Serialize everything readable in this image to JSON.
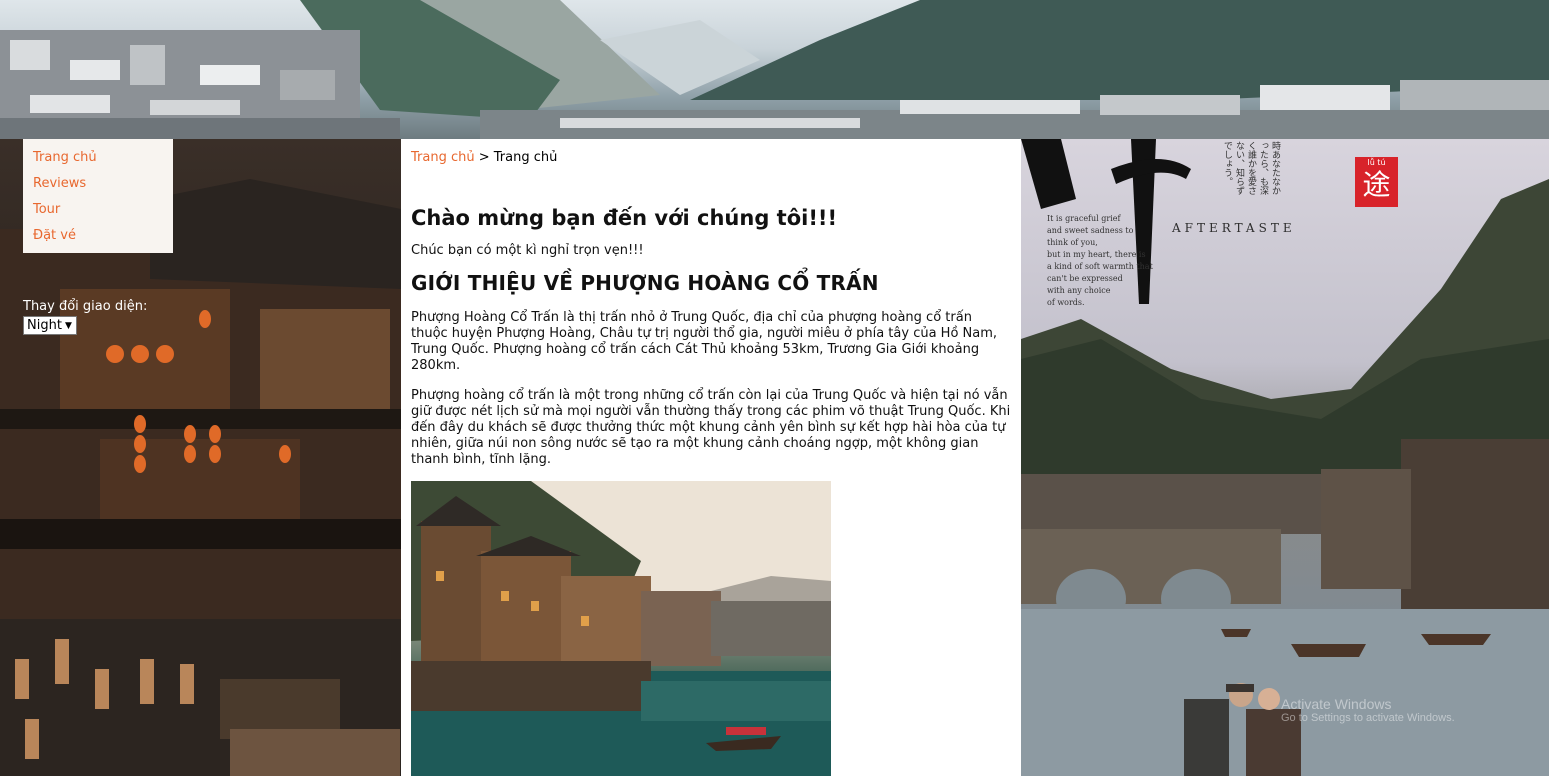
{
  "nav": {
    "items": [
      "Trang chủ",
      "Reviews",
      "Tour",
      "Đặt vé"
    ]
  },
  "theme": {
    "label": "Thay đổi giao diện:",
    "selected": "Night"
  },
  "breadcrumb": {
    "home": "Trang chủ",
    "separator": ">",
    "current": "Trang chủ"
  },
  "main": {
    "welcome": "Chào mừng bạn đến với chúng tôi!!!",
    "subwelcome": "Chúc bạn có một kì nghỉ trọn vẹn!!!",
    "intro_title": "GIỚI THIỆU VỀ PHƯỢNG HOÀNG CỔ TRẤN",
    "para1": "Phượng Hoàng Cổ Trấn là thị trấn nhỏ ở Trung Quốc, địa chỉ của phượng hoàng cổ trấn thuộc huyện Phượng Hoàng, Châu tự trị người thổ gia, người miêu ở phía tây của Hồ Nam, Trung Quốc. Phượng hoàng cổ trấn cách Cát Thủ khoảng 53km, Trương Gia Giới khoảng 280km.",
    "para2": "Phượng hoàng cổ trấn là một trong những cổ trấn còn lại của Trung Quốc và hiện tại nó vẫn giữ được nét lịch sử mà mọi người vẫn thường thấy trong các phim võ thuật Trung Quốc. Khi đến đây du khách sẽ được thưởng thức một khung cảnh yên bình sự kết hợp hài hòa của tự nhiên, giữa núi non sông nước sẽ tạo ra một khung cảnh choáng ngợp, một không gian thanh bình, tĩnh lặng."
  },
  "poster": {
    "poem": [
      "It is graceful grief",
      "and sweet sadness to",
      "think of you,",
      "but in my heart, there is",
      "a kind of soft warmth that",
      "can't be expressed",
      "with any choice",
      "of words."
    ],
    "title": "AFTERTASTE",
    "seal_small": "lǚ tú",
    "seal_big": "途",
    "jp": "時あなたなかったら、も深く誰かを愛さない、知らずでしょう。"
  },
  "watermark": {
    "line1": "Activate Windows",
    "line2": "Go to Settings to activate Windows."
  },
  "colors": {
    "accent": "#e8682f",
    "menu_bg": "#f8f4f0",
    "seal": "#d8232a"
  }
}
